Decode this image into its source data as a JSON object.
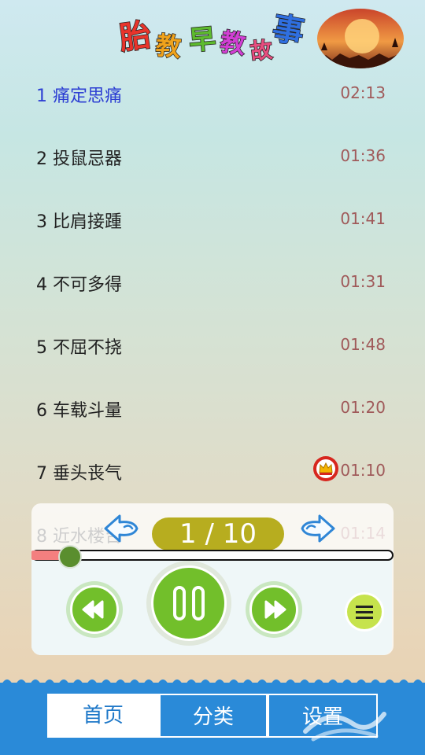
{
  "header": {
    "title_art": "胎教早教故事",
    "title_chars": [
      "胎",
      "教",
      "早",
      "教",
      "故",
      "事"
    ]
  },
  "songs": [
    {
      "name": "1 痛定思痛",
      "duration": "02:13",
      "active": true
    },
    {
      "name": "2 投鼠忌器",
      "duration": "01:36"
    },
    {
      "name": "3 比肩接踵",
      "duration": "01:41"
    },
    {
      "name": "4 不可多得",
      "duration": "01:31"
    },
    {
      "name": "5 不屈不挠",
      "duration": "01:48"
    },
    {
      "name": "6 车载斗量",
      "duration": "01:20"
    },
    {
      "name": "7 垂头丧气",
      "duration": "01:10",
      "badge": "crown-icon"
    },
    {
      "name": "8 近水楼台",
      "duration": "01:14"
    }
  ],
  "player": {
    "page_indicator": "1 / 10",
    "progress_fraction": 0.1,
    "colors": {
      "accent_green": "#72bf2b",
      "pill": "#b7ad1f",
      "progress_fill": "#f47f7f"
    }
  },
  "tabs": [
    {
      "label": "首页"
    },
    {
      "label": "分类"
    },
    {
      "label": "设置"
    }
  ]
}
